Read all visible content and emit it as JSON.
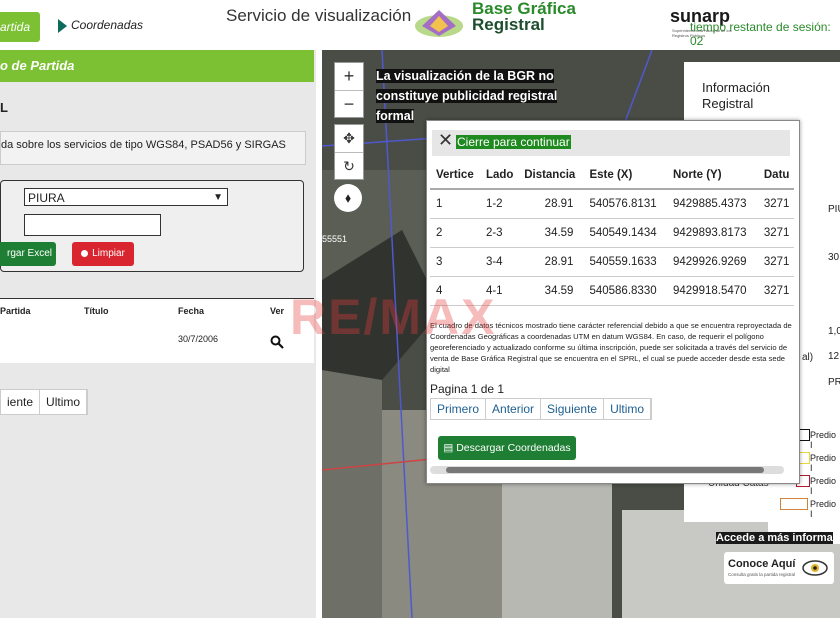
{
  "header": {
    "tab_partida": "artida",
    "tab_coordenadas": "Coordenadas",
    "service_title": "Servicio de visualización",
    "bgr_line1": "Base Gráfica",
    "bgr_line2": "Registral",
    "sunarp": "sunarp",
    "sunarp_sub": "Superintendencia Nacional de los Registros Públicos",
    "sesion": "tiempo restante de sesión: 02"
  },
  "left_panel": {
    "header": "o de Partida",
    "label_l": "L",
    "info_text": "da sobre los servicios de tipo WGS84, PSAD56 y SIRGAS",
    "select_value": "PIURA",
    "input_value": "",
    "btn_excel": "rgar Excel",
    "btn_limpiar": "Limpiar",
    "columns": [
      "Partida",
      "Título",
      "Fecha",
      "Ver"
    ],
    "row": {
      "fecha": "30/7/2006"
    },
    "pager": [
      "iente",
      "Ultimo"
    ]
  },
  "map": {
    "notice_l1": "La visualización de la BGR no",
    "notice_l2": "constituye publicidad registral formal",
    "parcel_label": "55551",
    "info_title_l1": "Información",
    "info_title_l2": "Registral",
    "info_values": [
      "PIU",
      "30",
      "1,0",
      "12",
      "PR",
      "al)"
    ],
    "legend": [
      "Predio I",
      "Predio I",
      "Predio I",
      "Predio I"
    ],
    "unidad": "Unidad Catas",
    "accede": "Accede a más informa",
    "conoce": "Conoce Aquí",
    "conoce_sub": "Consulta gratis la partida registral"
  },
  "modal": {
    "close_label": "Cierre para continuar",
    "columns": [
      "Vertice",
      "Lado",
      "Distancia",
      "Este (X)",
      "Norte (Y)",
      "Datu"
    ],
    "rows": [
      {
        "vertice": "1",
        "lado": "1-2",
        "distancia": "28.91",
        "este": "540576.8131",
        "norte": "9429885.4373",
        "datum": "3271"
      },
      {
        "vertice": "2",
        "lado": "2-3",
        "distancia": "34.59",
        "este": "540549.1434",
        "norte": "9429893.8173",
        "datum": "3271"
      },
      {
        "vertice": "3",
        "lado": "3-4",
        "distancia": "28.91",
        "este": "540559.1633",
        "norte": "9429926.9269",
        "datum": "3271"
      },
      {
        "vertice": "4",
        "lado": "4-1",
        "distancia": "34.59",
        "este": "540586.8330",
        "norte": "9429918.5470",
        "datum": "3271"
      }
    ],
    "note": "El cuadro de datos técnicos mostrado tiene carácter referencial debido a que se encuentra reproyectada de Coordenadas Geográficas a coordenadas UTM en datum WGS84. En caso, de requerir el polígono georeferenciado y actualizado conforme su última inscripción, puede ser solicitada a través del servicio de venta de Base Gráfica Registral que se encuentra en el SPRL, el cual se puede acceder desde esta sede digital",
    "pagina": "Pagina 1 de 1",
    "pager": [
      "Primero",
      "Anterior",
      "Siguiente",
      "Ultimo"
    ],
    "btn_descargar": "Descargar Coordenadas"
  },
  "watermark": "RE/MAX",
  "colors": {
    "green": "#7cc133",
    "dark_green": "#1e7e34",
    "red": "#d9252f"
  }
}
